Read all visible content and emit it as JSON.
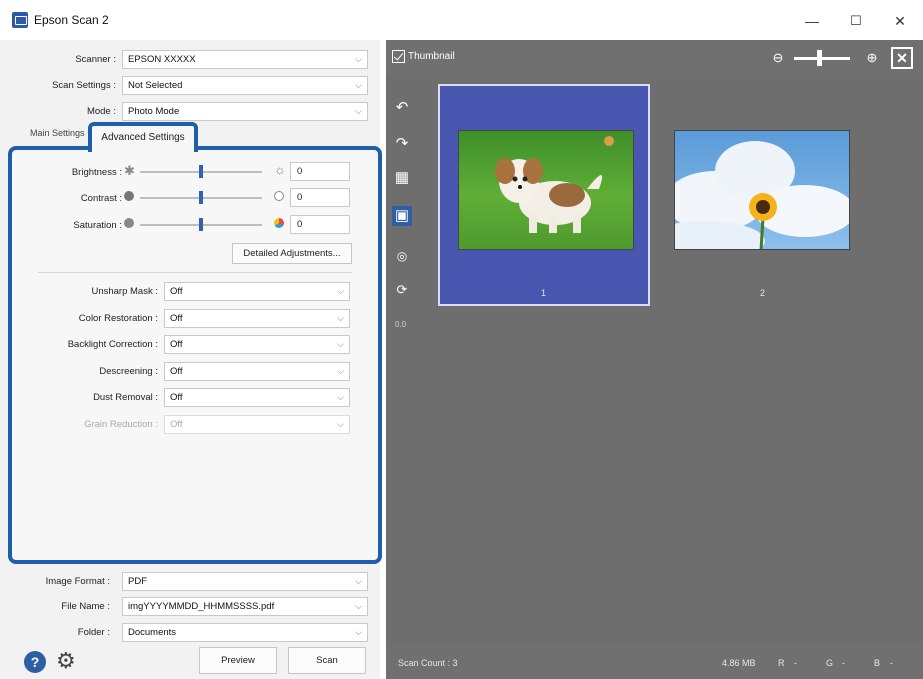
{
  "window": {
    "title": "Epson Scan 2",
    "minimize": "—",
    "maximize": "☐",
    "close": "✕"
  },
  "top_fields": {
    "scanner_label": "Scanner :",
    "scanner_value": "EPSON XXXXX",
    "scan_settings_label": "Scan Settings :",
    "scan_settings_value": "Not Selected",
    "mode_label": "Mode :",
    "mode_value": "Photo Mode"
  },
  "tabs": {
    "main_label": "Main Settings",
    "advanced_label": "Advanced Settings"
  },
  "adjustments": {
    "brightness_label": "Brightness :",
    "brightness_value": "0",
    "contrast_label": "Contrast :",
    "contrast_value": "0",
    "saturation_label": "Saturation :",
    "saturation_value": "0",
    "brightness_level": 0.5,
    "contrast_level": 0.5,
    "saturation_level": 0.5,
    "detailed_button": "Detailed Adjustments..."
  },
  "image_options": [
    {
      "label": "Unsharp Mask :",
      "value": "Off",
      "enabled": true
    },
    {
      "label": "Color Restoration :",
      "value": "Off",
      "enabled": true
    },
    {
      "label": "Backlight Correction :",
      "value": "Off",
      "enabled": true
    },
    {
      "label": "Descreening :",
      "value": "Off",
      "enabled": true
    },
    {
      "label": "Dust Removal :",
      "value": "Off",
      "enabled": true
    },
    {
      "label": "Grain Reduction :",
      "value": "Off",
      "enabled": false
    }
  ],
  "output": {
    "image_format_label": "Image Format :",
    "image_format_value": "PDF",
    "file_name_label": "File Name :",
    "file_name_value": "imgYYYYMMDD_HHMMSSSS.pdf",
    "folder_label": "Folder :",
    "folder_value": "Documents"
  },
  "buttons": {
    "preview": "Preview",
    "scan": "Scan"
  },
  "preview": {
    "thumbnail_label": "Thumbnail",
    "rotation_readout": "0.0",
    "thumbnails": [
      {
        "number": "1",
        "selected": true,
        "subject": "puppy on grass"
      },
      {
        "number": "2",
        "selected": false,
        "subject": "sunflower against sky"
      }
    ]
  },
  "status": {
    "scan_count": "Scan Count : 3",
    "size": "4.86 MB",
    "r": "R",
    "r_value": "-",
    "g": "G",
    "g_value": "-",
    "b": "B",
    "b_value": "-"
  },
  "colors": {
    "accent": "#1f5ea8",
    "selected_thumb": "#4a57b0",
    "preview_bg": "#6e6e6e"
  },
  "icons": [
    "help-icon",
    "gear-icon",
    "zoom-out-icon",
    "zoom-in-icon",
    "close-preview-icon",
    "rotate-left-icon",
    "rotate-right-icon",
    "image-correction-icon",
    "auto-crop-icon",
    "scan-area-icon"
  ]
}
